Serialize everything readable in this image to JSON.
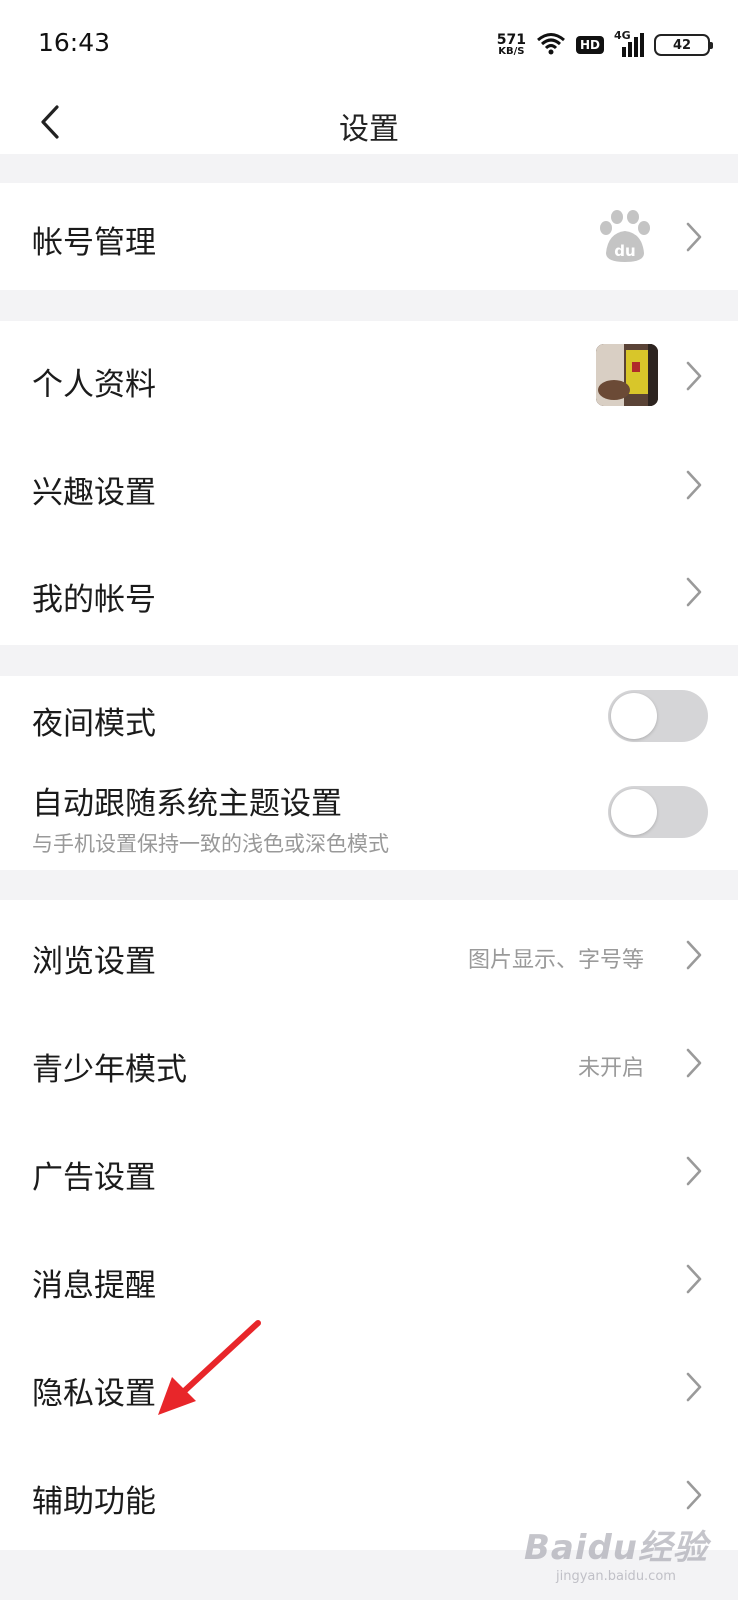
{
  "statusbar": {
    "time": "16:43",
    "net_speed_value": "571",
    "net_speed_unit": "KB/S",
    "hd_label": "HD",
    "network_label": "4G",
    "battery_level": "42"
  },
  "navbar": {
    "title": "设置"
  },
  "sections": {
    "account": {
      "account_manage": "帐号管理"
    },
    "profile": {
      "personal_info": "个人资料",
      "interest_settings": "兴趣设置",
      "my_account": "我的帐号"
    },
    "display": {
      "night_mode": "夜间模式",
      "night_mode_on": false,
      "auto_theme": "自动跟随系统主题设置",
      "auto_theme_desc": "与手机设置保持一致的浅色或深色模式",
      "auto_theme_on": false
    },
    "general": {
      "browse_settings": "浏览设置",
      "browse_settings_value": "图片显示、字号等",
      "teen_mode": "青少年模式",
      "teen_mode_value": "未开启",
      "ad_settings": "广告设置",
      "message_reminder": "消息提醒",
      "privacy_settings": "隐私设置",
      "accessibility": "辅助功能"
    }
  },
  "annotation": {
    "arrow_color": "#e8262a"
  },
  "watermark": {
    "brand": "Baidu经验",
    "url": "jingyan.baidu.com"
  }
}
